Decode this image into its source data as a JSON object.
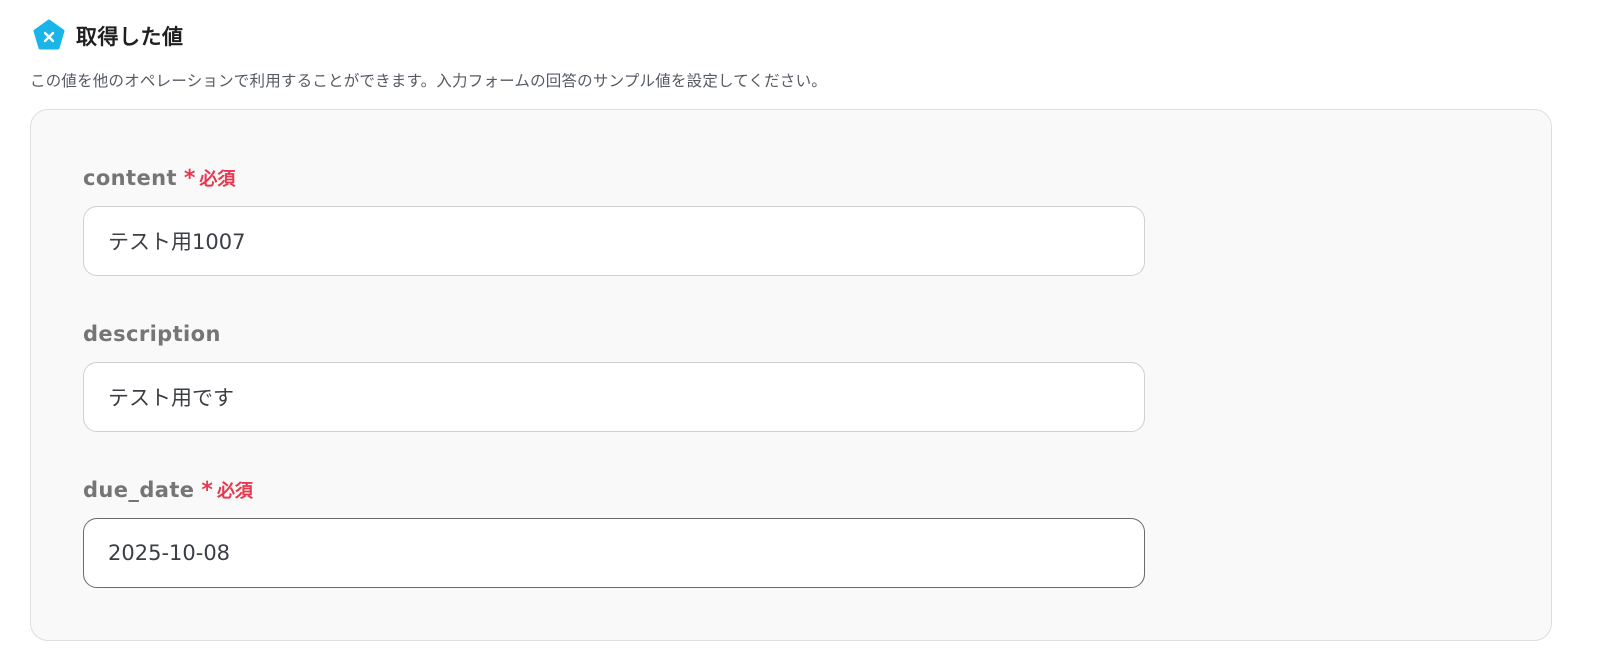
{
  "section": {
    "title": "取得した値",
    "icon": "pentagon-x-icon",
    "icon_color": "#1ab5e8",
    "description": "この値を他のオペレーションで利用することができます。入力フォームの回答のサンプル値を設定してください。"
  },
  "fields": [
    {
      "label": "content",
      "required": true,
      "required_star": "*",
      "required_text": "必須",
      "value": "テスト用1007"
    },
    {
      "label": "description",
      "required": false,
      "value": "テスト用です"
    },
    {
      "label": "due_date",
      "required": true,
      "required_star": "*",
      "required_text": "必須",
      "value": "2025-10-08"
    }
  ],
  "colors": {
    "required": "#e8384f",
    "panel_background": "#f9f9f9",
    "label": "#757575"
  }
}
